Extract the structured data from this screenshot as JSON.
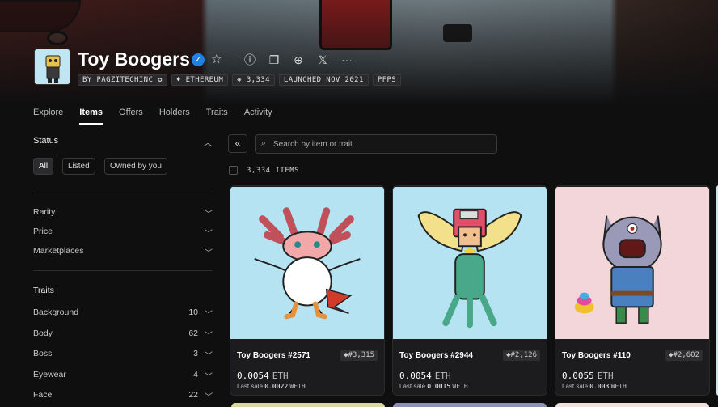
{
  "collection": {
    "title": "Toy Boogers",
    "chips": [
      "BY PAGZITECHINC",
      "ETHEREUM",
      "3,334",
      "LAUNCHED NOV 2021",
      "PFPS"
    ]
  },
  "tabs": [
    "Explore",
    "Items",
    "Offers",
    "Holders",
    "Traits",
    "Activity"
  ],
  "active_tab": "Items",
  "sidebar": {
    "status_heading": "Status",
    "status_pills": [
      "All",
      "Listed",
      "Owned by you"
    ],
    "filters": [
      "Rarity",
      "Price",
      "Marketplaces"
    ],
    "traits_heading": "Traits",
    "traits": [
      {
        "label": "Background",
        "count": "10"
      },
      {
        "label": "Body",
        "count": "62"
      },
      {
        "label": "Boss",
        "count": "3"
      },
      {
        "label": "Eyewear",
        "count": "4"
      },
      {
        "label": "Face",
        "count": "22"
      }
    ]
  },
  "toolbar": {
    "search_placeholder": "Search by item or trait",
    "items_count": "3,334 ITEMS"
  },
  "cards": [
    {
      "name": "Toy Boogers #2571",
      "rank": "#3,315",
      "price": "0.0054",
      "currency": "ETH",
      "last_sale_label": "Last sale",
      "last_sale": "0.0022",
      "last_sale_currency": "WETH",
      "bg": "#b5e3f1"
    },
    {
      "name": "Toy Boogers #2944",
      "rank": "#2,126",
      "price": "0.0054",
      "currency": "ETH",
      "last_sale_label": "Last sale",
      "last_sale": "0.0015",
      "last_sale_currency": "WETH",
      "bg": "#b5e3f1"
    },
    {
      "name": "Toy Boogers #110",
      "rank": "#2,602",
      "price": "0.0055",
      "currency": "ETH",
      "last_sale_label": "Last sale",
      "last_sale": "0.003",
      "last_sale_currency": "WETH",
      "bg": "#f3d6da"
    }
  ]
}
